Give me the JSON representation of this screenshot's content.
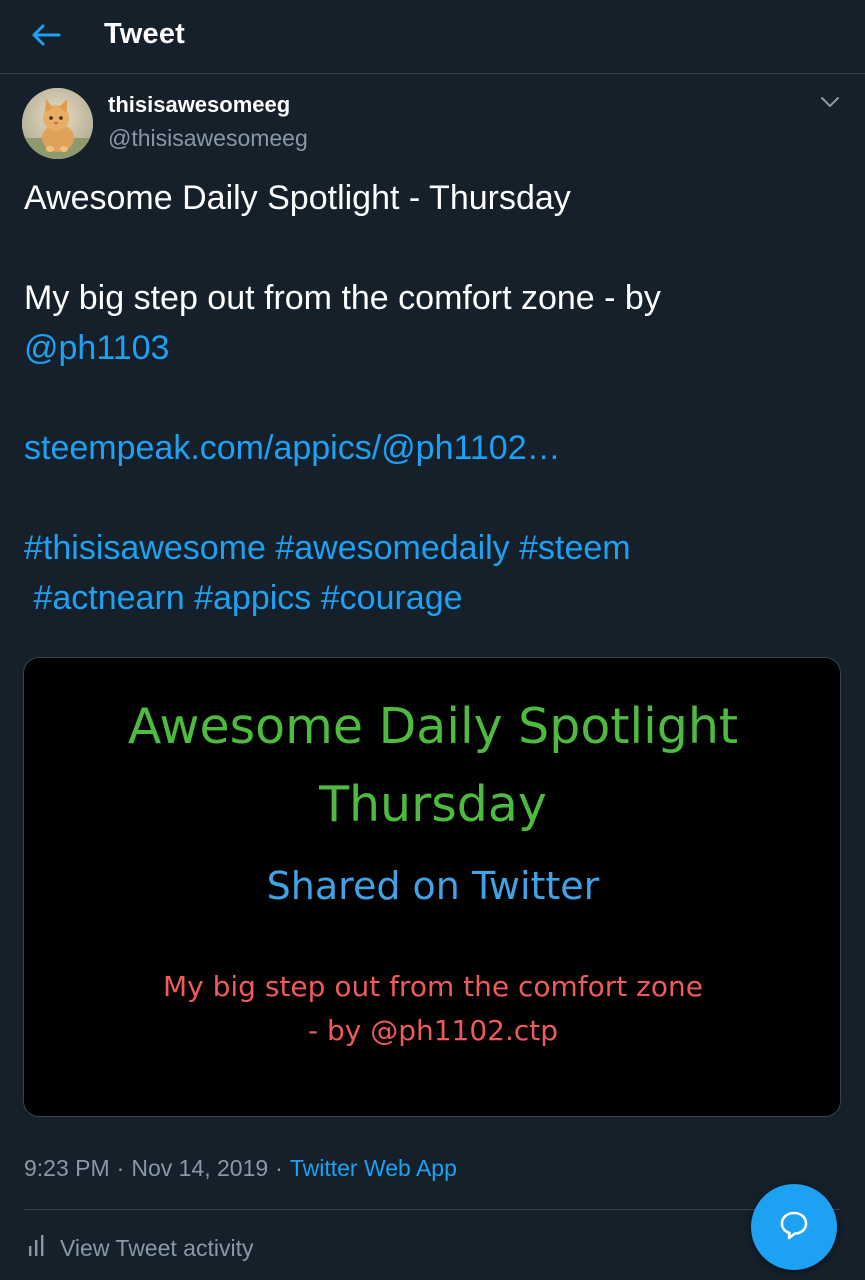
{
  "header": {
    "title": "Tweet",
    "back_icon": "arrow-left-icon"
  },
  "author": {
    "display_name": "thisisawesomeeg",
    "handle": "@thisisawesomeeg",
    "avatar": "kitten-avatar"
  },
  "tweet": {
    "line1": "Awesome Daily Spotlight - Thursday",
    "line2": "My big step out from the comfort zone - by",
    "mention": "@ph1103",
    "url": "steempeak.com/appics/@ph1102…",
    "hashtags_line1": "#thisisawesome #awesomedaily #steem",
    "hashtags_line2": " #actnearn #appics #courage"
  },
  "media": {
    "line1": "Awesome Daily Spotlight",
    "line2": "Thursday",
    "line3": "Shared on Twitter",
    "line4": "My big step out from the comfort zone",
    "line5": "- by @ph1102.ctp",
    "colors": {
      "green": "#4cbb3e",
      "blue": "#3fa3e5",
      "red": "#ef5a5a"
    }
  },
  "meta": {
    "time": "9:23 PM",
    "separator": "·",
    "date": "Nov 14, 2019",
    "source": "Twitter Web App"
  },
  "activity": {
    "label": "View Tweet activity",
    "icon": "bar-chart-icon"
  },
  "fab": {
    "icon": "reply-bubble-icon"
  },
  "colors": {
    "background": "#15202b",
    "accent": "#1da1f2",
    "muted": "#8899a6",
    "border": "#38444d"
  }
}
